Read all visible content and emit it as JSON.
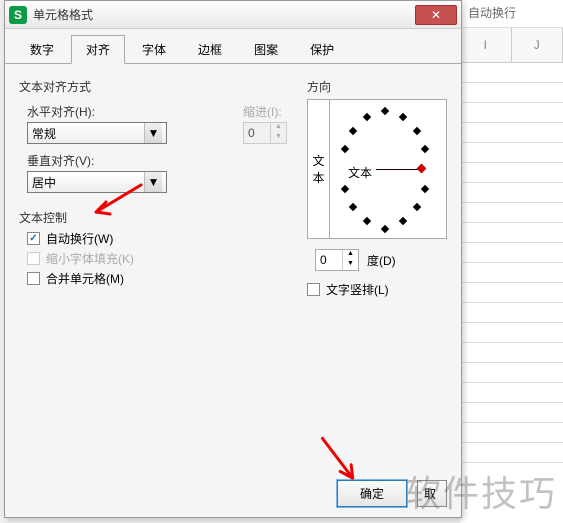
{
  "bg": {
    "toolbarBtn": "自动换行",
    "cols": [
      "I",
      "J"
    ]
  },
  "dialog": {
    "title": "单元格格式",
    "closeGlyph": "✕",
    "tabs": [
      "数字",
      "对齐",
      "字体",
      "边框",
      "图案",
      "保护"
    ],
    "activeTab": 1
  },
  "align": {
    "groupLabel": "文本对齐方式",
    "hLabel": "水平对齐(H):",
    "hValue": "常规",
    "indentLabel": "缩进(I):",
    "indentValue": "0",
    "vLabel": "垂直对齐(V):",
    "vValue": "居中"
  },
  "textControl": {
    "groupLabel": "文本控制",
    "wrap": {
      "label": "自动换行(W)",
      "checked": true
    },
    "shrink": {
      "label": "缩小字体填充(K)",
      "checked": false,
      "disabled": true
    },
    "merge": {
      "label": "合并单元格(M)",
      "checked": false
    }
  },
  "orient": {
    "groupLabel": "方向",
    "vertText1": "文",
    "vertText2": "本",
    "dialText": "文本",
    "degValue": "0",
    "degLabel": "度(D)",
    "verticalLabel": "文字竖排(L)"
  },
  "buttons": {
    "ok": "确定",
    "cancel": "取"
  },
  "watermark": "软件技巧"
}
